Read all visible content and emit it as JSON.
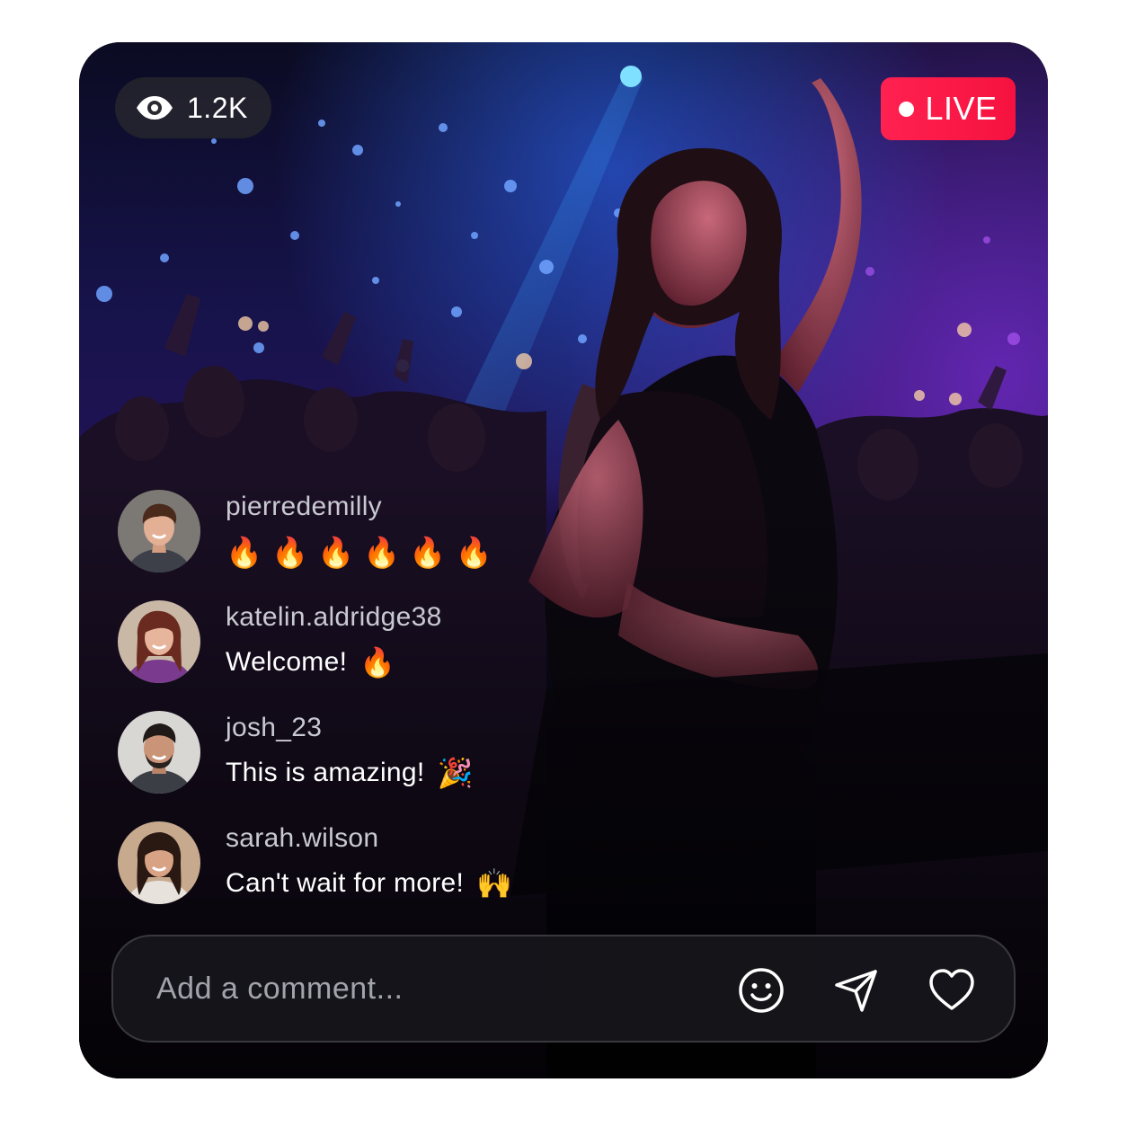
{
  "stream": {
    "viewer_count": "1.2K",
    "live_label": "LIVE",
    "accent_color": "#f6123f"
  },
  "icons": {
    "viewers": "eye-icon",
    "emoji": "smiley-icon",
    "send": "paper-plane-icon",
    "like": "heart-icon"
  },
  "comments": [
    {
      "username": "pierredemilly",
      "text": "",
      "emoji": "🔥🔥🔥🔥🔥🔥"
    },
    {
      "username": "katelin.aldridge38",
      "text": "Welcome!",
      "emoji": "🔥"
    },
    {
      "username": "josh_23",
      "text": "This is amazing!",
      "emoji": "🎉"
    },
    {
      "username": "sarah.wilson",
      "text": "Can't wait for more!",
      "emoji": "🙌"
    }
  ],
  "composer": {
    "placeholder": "Add a comment...",
    "value": ""
  }
}
